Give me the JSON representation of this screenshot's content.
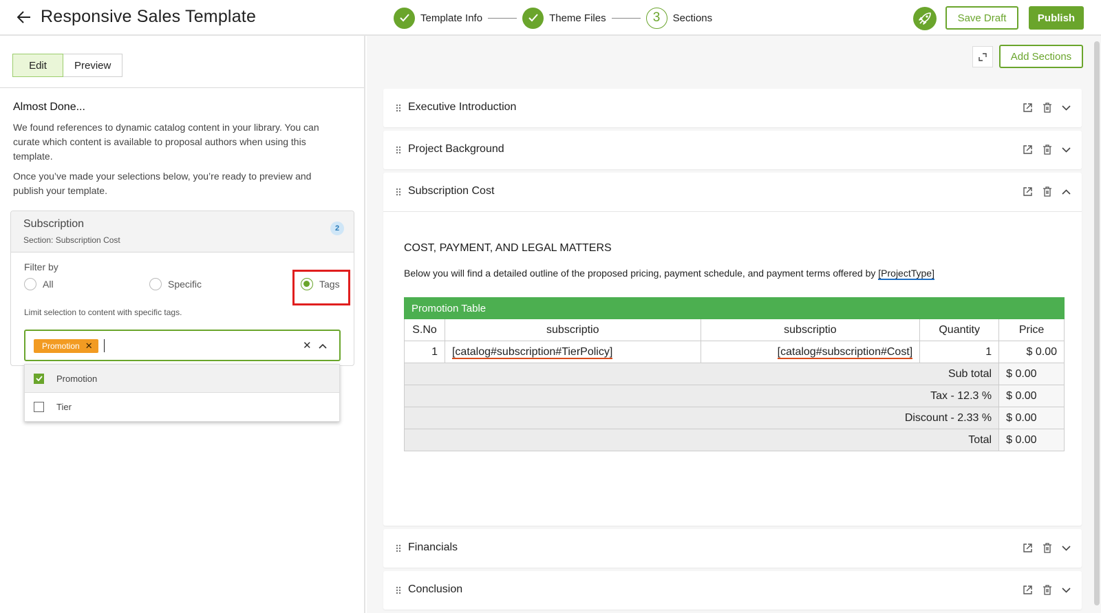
{
  "header": {
    "title": "Responsive Sales Template",
    "steps": [
      {
        "label": "Template Info"
      },
      {
        "label": "Theme Files"
      },
      {
        "label": "Sections",
        "number": "3"
      }
    ],
    "save_draft_label": "Save Draft",
    "publish_label": "Publish"
  },
  "left": {
    "tabs": {
      "edit": "Edit",
      "preview": "Preview"
    },
    "heading": "Almost Done...",
    "para1": "We found references to dynamic catalog content in your library. You can curate which content is available to proposal authors when using this template.",
    "para2": "Once you’ve made your selections below, you’re ready to preview and publish your template.",
    "card": {
      "title": "Subscription",
      "meta": "Section: Subscription Cost",
      "count": "2",
      "filter_label": "Filter by",
      "options": [
        "All",
        "Specific",
        "Tags"
      ],
      "selected_option": "Tags",
      "limit_text": "Limit selection to content with specific tags.",
      "chip": "Promotion",
      "dropdown": [
        {
          "label": "Promotion",
          "checked": true
        },
        {
          "label": "Tier",
          "checked": false
        }
      ]
    }
  },
  "right": {
    "add_sections_label": "Add Sections",
    "sections": [
      {
        "title": "Executive Introduction",
        "expanded": false
      },
      {
        "title": "Project Background",
        "expanded": false
      },
      {
        "title": "Subscription Cost",
        "expanded": true
      },
      {
        "title": "Financials",
        "expanded": false
      },
      {
        "title": "Conclusion",
        "expanded": false
      }
    ],
    "content": {
      "heading": "COST, PAYMENT, AND LEGAL MATTERS",
      "para_text": "Below you will find a detailed outline of the proposed pricing, payment schedule, and payment terms offered by ",
      "para_var": "[ProjectType]",
      "table": {
        "title": "Promotion Table",
        "headers": [
          "S.No",
          "subscriptio",
          "subscriptio",
          "Quantity",
          "Price"
        ],
        "row": [
          "1",
          "[catalog#subscription#TierPolicy]",
          "[catalog#subscription#Cost]",
          "1",
          "$ 0.00"
        ],
        "summary": [
          {
            "label": "Sub total",
            "value": "$ 0.00"
          },
          {
            "label": "Tax - 12.3 %",
            "value": "$ 0.00"
          },
          {
            "label": "Discount - 2.33 %",
            "value": "$ 0.00"
          },
          {
            "label": "Total",
            "value": "$ 0.00"
          }
        ]
      }
    }
  },
  "colors": {
    "accent": "#6aa52c",
    "chip": "#f29b22",
    "table_header": "#4caf50",
    "highlight": "#e01e1e"
  }
}
